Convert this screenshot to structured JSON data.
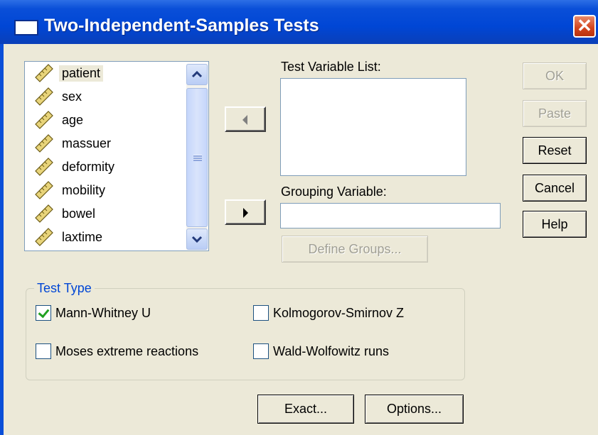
{
  "window": {
    "title": "Two-Independent-Samples Tests",
    "close_symbol": "✕"
  },
  "variables": [
    {
      "name": "patient",
      "selected": true
    },
    {
      "name": "sex"
    },
    {
      "name": "age"
    },
    {
      "name": "massuer"
    },
    {
      "name": "deformity"
    },
    {
      "name": "mobility"
    },
    {
      "name": "bowel"
    },
    {
      "name": "laxtime"
    }
  ],
  "test_variable_list": {
    "label": "Test Variable List:",
    "items": []
  },
  "grouping_variable": {
    "label": "Grouping Variable:",
    "value": ""
  },
  "define_groups_label": "Define Groups...",
  "buttons": {
    "ok": "OK",
    "paste": "Paste",
    "reset": "Reset",
    "cancel": "Cancel",
    "help": "Help",
    "exact": "Exact...",
    "options": "Options..."
  },
  "test_type": {
    "title": "Test Type",
    "mann_whitney": {
      "label": "Mann-Whitney U",
      "checked": true
    },
    "kolmogorov": {
      "label": "Kolmogorov-Smirnov Z",
      "checked": false
    },
    "moses": {
      "label": "Moses extreme reactions",
      "checked": false
    },
    "wald": {
      "label": "Wald-Wolfowitz runs",
      "checked": false
    }
  },
  "colors": {
    "title_bar": "#0046d5",
    "dialog_bg": "#ece9d8",
    "group_title": "#0046d5"
  }
}
